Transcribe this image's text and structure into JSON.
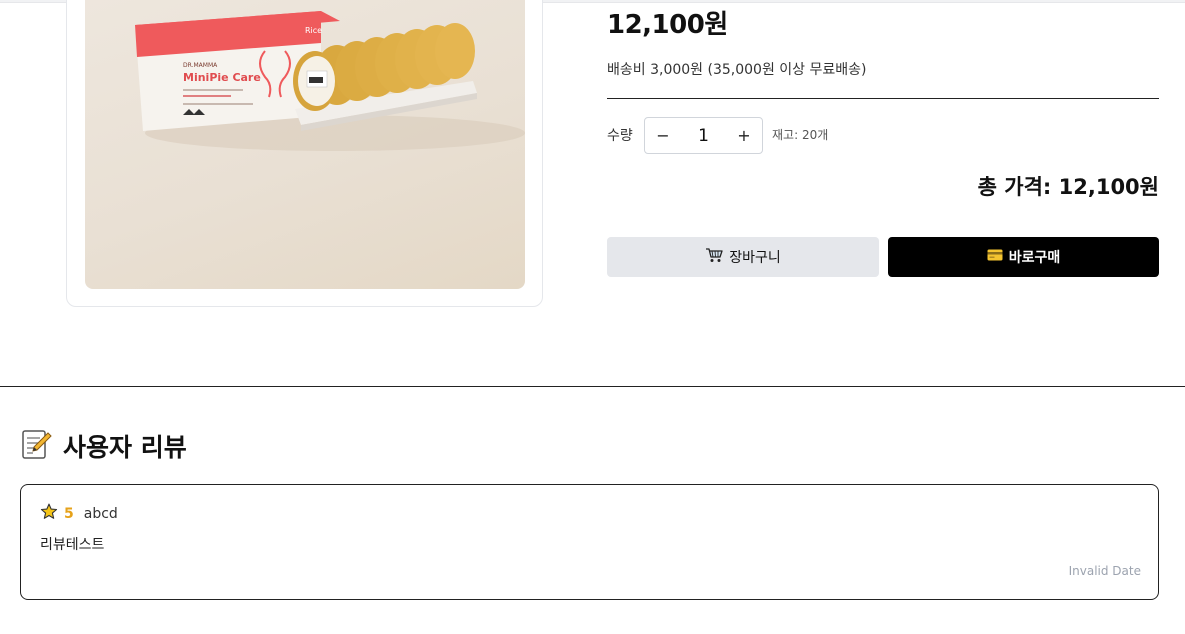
{
  "product": {
    "price": "12,100원",
    "shipping": "배송비 3,000원 (35,000원 이상 무료배송)",
    "quantity_label": "수량",
    "quantity_value": "1",
    "decrement": "−",
    "increment": "+",
    "stock": "재고: 20개",
    "total": "총 가격: 12,100원",
    "cart_label": "장바구니",
    "buy_label": "바로구매",
    "image_brand": "DR.MAMMA",
    "image_name": "MiniPie Care",
    "image_variant": "Rice"
  },
  "icons": {
    "cart": "shopping-cart-icon",
    "card": "credit-card-icon",
    "memo": "memo-icon",
    "star": "star-icon"
  },
  "reviews": {
    "title": "사용자 리뷰",
    "items": [
      {
        "rating": "5",
        "user": "abcd",
        "body": "리뷰테스트",
        "date": "Invalid Date"
      }
    ]
  },
  "colors": {
    "accent_buy": "#000000",
    "cart_bg": "#e5e7eb",
    "box_red": "#ef5a5c",
    "star": "#f5c518"
  }
}
